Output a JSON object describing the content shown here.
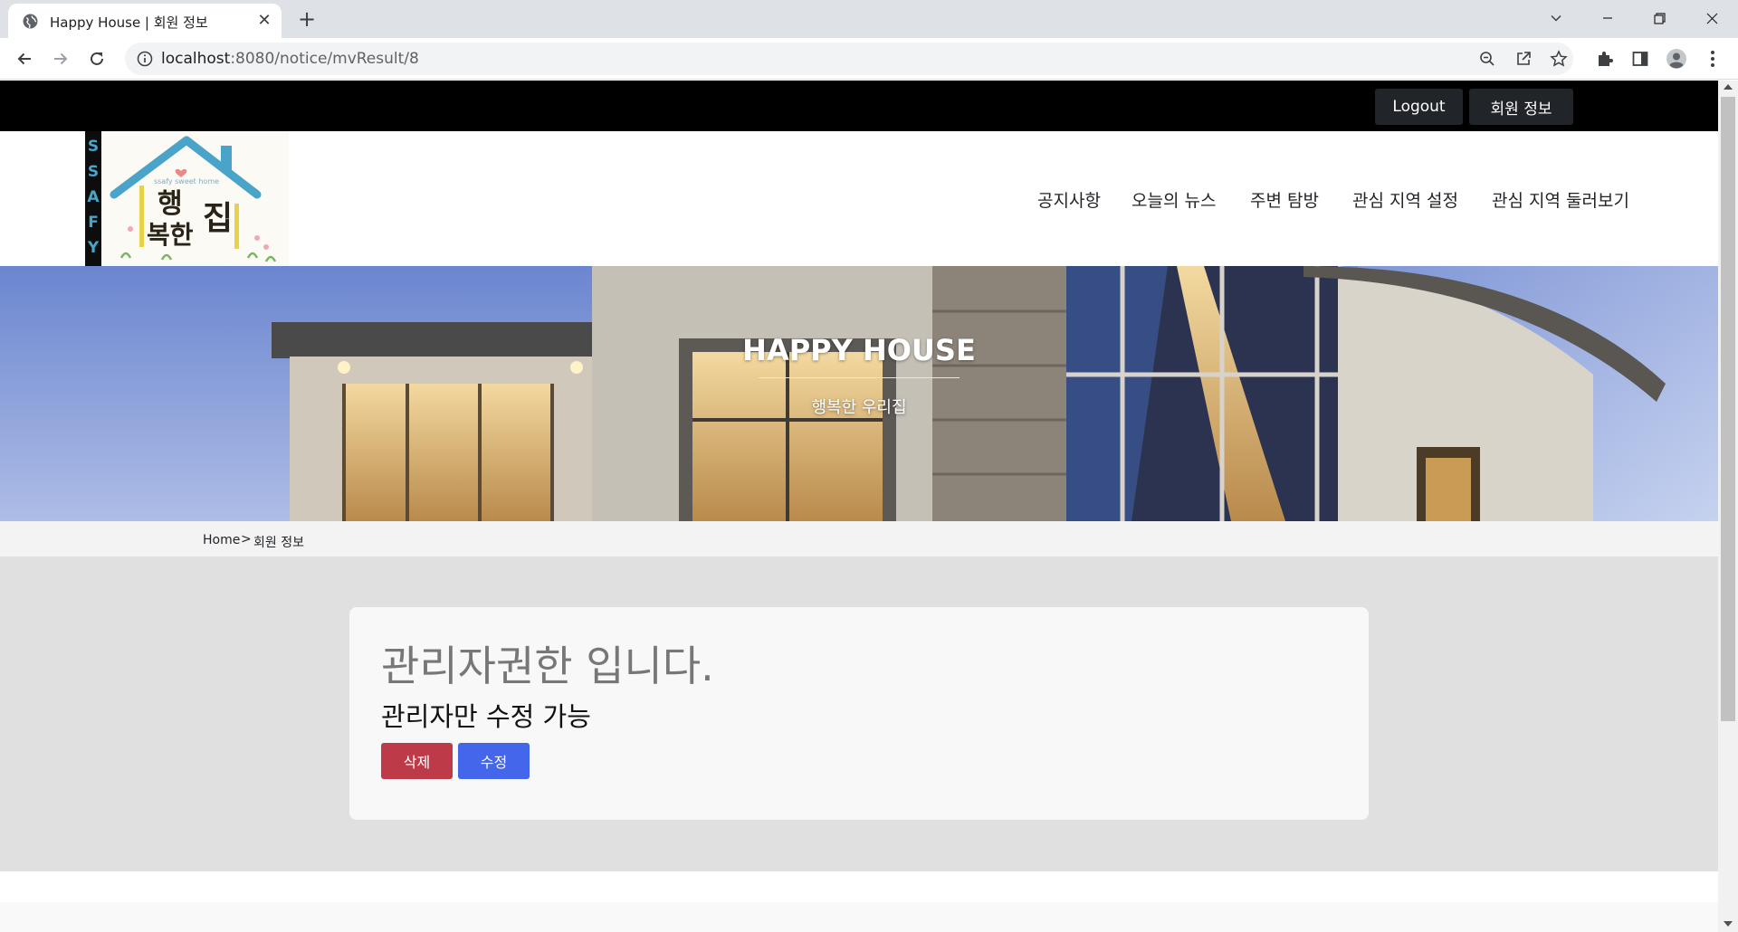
{
  "browser": {
    "tab_title": "Happy House | 회원 정보",
    "url_host": "localhost",
    "url_rest": ":8080/notice/mvResult/8"
  },
  "topbar": {
    "logout_label": "Logout",
    "member_info_label": "회원 정보"
  },
  "nav": {
    "items": [
      {
        "label": "공지사항"
      },
      {
        "label": "오늘의 뉴스"
      },
      {
        "label": "주변 탐방"
      },
      {
        "label": "관심 지역 설정"
      },
      {
        "label": "관심 지역 둘러보기"
      }
    ]
  },
  "logo": {
    "side_letters": "SSAFY",
    "text_top": "행",
    "text_bottom": "복한",
    "text_side": "집",
    "tagline": "ssafy sweet home"
  },
  "hero": {
    "title": "HAPPY HOUSE",
    "subtitle": "행복한 우리집"
  },
  "breadcrumb": {
    "home": "Home",
    "separator": ">",
    "current": "회원 정보"
  },
  "card": {
    "heading": "관리자권한 입니다.",
    "subheading": "관리자만 수정 가능",
    "delete_label": "삭제",
    "edit_label": "수정"
  },
  "colors": {
    "topbar": "#000000",
    "button_dark": "#212529",
    "delete": "#bd3b48",
    "edit": "#4466ea",
    "main_bg": "#e0e0e0",
    "card_bg": "#f8f8f8"
  }
}
